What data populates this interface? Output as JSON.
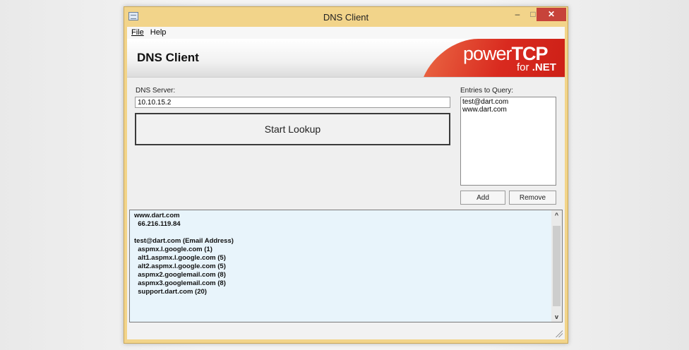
{
  "window": {
    "title": "DNS Client",
    "controls": {
      "minimize": "–",
      "maximize": "□",
      "close": "✕"
    }
  },
  "menu": {
    "file": "File",
    "help": "Help"
  },
  "banner": {
    "title": "DNS Client",
    "logo_power": "power",
    "logo_tcp": "TCP",
    "logo_for": "for",
    "logo_net": ".NET"
  },
  "dns_server": {
    "label": "DNS Server:",
    "value": "10.10.15.2"
  },
  "start_button": "Start Lookup",
  "entries": {
    "label": "Entries to Query:",
    "items": [
      "test@dart.com",
      "www.dart.com"
    ],
    "add_label": "Add",
    "remove_label": "Remove"
  },
  "results": {
    "lines": [
      "www.dart.com",
      "  66.216.119.84",
      "",
      "test@dart.com (Email Address)",
      "  aspmx.l.google.com (1)",
      "  alt1.aspmx.l.google.com (5)",
      "  alt2.aspmx.l.google.com (5)",
      "  aspmx2.googlemail.com (8)",
      "  aspmx3.googlemail.com (8)",
      "  support.dart.com (20)"
    ]
  },
  "scroll": {
    "up": "^",
    "down": "v"
  },
  "colors": {
    "window_frame": "#f2d48a",
    "close_button": "#c7433a",
    "results_bg": "#e8f4fb",
    "logo_red": "#d92a1f"
  }
}
